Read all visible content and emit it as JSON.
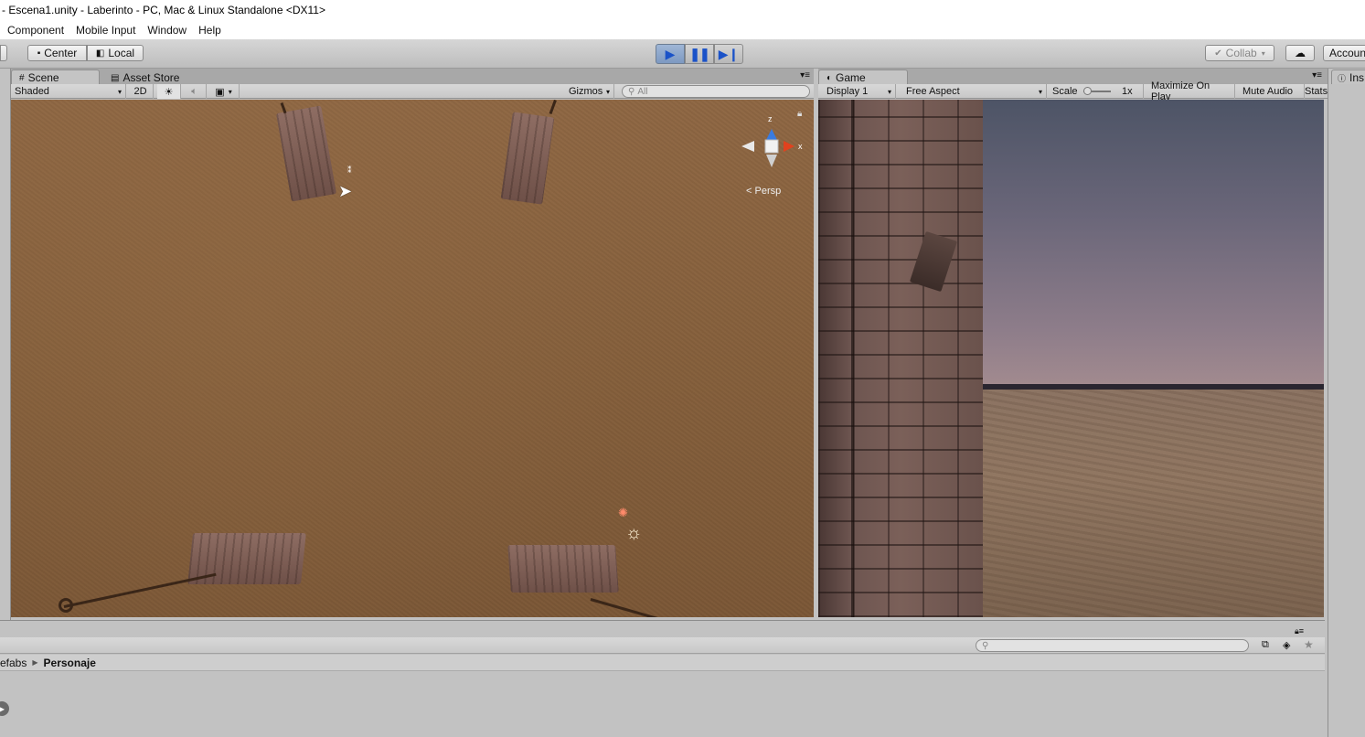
{
  "window": {
    "title": "- Escena1.unity - Laberinto - PC, Mac & Linux Standalone <DX11>"
  },
  "menu": [
    "Component",
    "Mobile Input",
    "Window",
    "Help"
  ],
  "toolbar": {
    "pivot_label": "Center",
    "space_label": "Local",
    "collab_label": "Collab",
    "account_label": "Accoun",
    "play_icon": "play-icon",
    "pause_icon": "pause-icon",
    "step_icon": "step-icon"
  },
  "scene_panel": {
    "tabs": [
      {
        "label": "Scene",
        "icon": "grid-icon",
        "active": true
      },
      {
        "label": "Asset Store",
        "icon": "store-icon",
        "active": false
      }
    ],
    "shading_mode": "Shaded",
    "mode_2d": "2D",
    "gizmos_label": "Gizmos",
    "search_placeholder": "All",
    "persp_label": "Persp",
    "axis_x": "x",
    "axis_z": "z"
  },
  "game_panel": {
    "tab_label": "Game",
    "display": "Display 1",
    "aspect": "Free Aspect",
    "scale_label": "Scale",
    "scale_value": "1x",
    "maximize_label": "Maximize On Play",
    "mute_label": "Mute Audio",
    "stats_label": "Stats"
  },
  "inspector": {
    "tab_label": "Ins"
  },
  "project_panel": {
    "breadcrumb": [
      "efabs",
      "Personaje"
    ]
  },
  "colors": {
    "play_accent": "#1a52c8",
    "scene_ground": "#85603d"
  }
}
